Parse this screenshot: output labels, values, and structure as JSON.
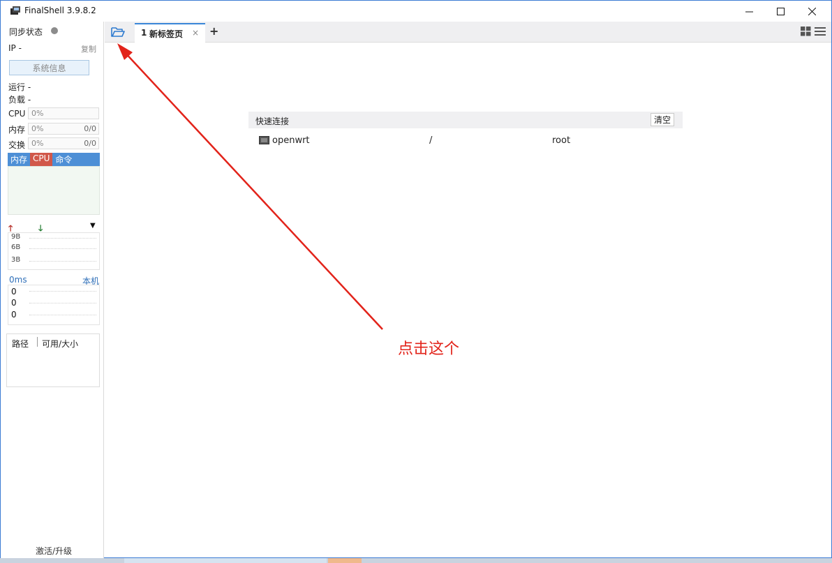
{
  "window": {
    "title": "FinalShell 3.9.8.2",
    "min_glyph": "—",
    "max_glyph": "☐",
    "close_glyph": "✕"
  },
  "sidebar": {
    "sync_label": "同步状态",
    "ip_label": "IP  -",
    "copy_label": "复制",
    "sysinfo_button": "系统信息",
    "run_label": "运行 -",
    "load_label": "负载 -",
    "cpu": {
      "label": "CPU",
      "percent": "0%"
    },
    "mem": {
      "label": "内存",
      "percent": "0%",
      "ratio": "0/0"
    },
    "swap": {
      "label": "交换",
      "percent": "0%",
      "ratio": "0/0"
    },
    "proc_tabs": [
      "内存",
      "CPU",
      "命令"
    ],
    "net": {
      "up_icon": "arrow-up-icon",
      "down_icon": "arrow-down-icon",
      "up_glyph": "🡑",
      "down_glyph": "🡓",
      "menu_glyph": "▼",
      "labels": [
        "9B",
        "6B",
        "3B"
      ]
    },
    "ping": {
      "latency": "0ms",
      "host": "本机",
      "values": [
        "0",
        "0",
        "0"
      ]
    },
    "disk": {
      "col_path": "路径",
      "col_size": "可用/大小"
    },
    "activate_label": "激活/升级"
  },
  "tabbar": {
    "tab_number": "1",
    "tab_label": "新标签页",
    "tab_close": "×",
    "add_tab": "+"
  },
  "quick_connect": {
    "title": "快速连接",
    "clear_button": "清空",
    "rows": [
      {
        "name": "openwrt",
        "path": "/",
        "user": "root"
      }
    ]
  },
  "annotation": {
    "text": "点击这个",
    "color": "#e2231a"
  },
  "colors": {
    "accent": "#3a86d8",
    "proc_tab_bg": "#4d8fd6",
    "cpu_tab_bg": "#d1584a",
    "ping_text": "#2f6fb8"
  }
}
